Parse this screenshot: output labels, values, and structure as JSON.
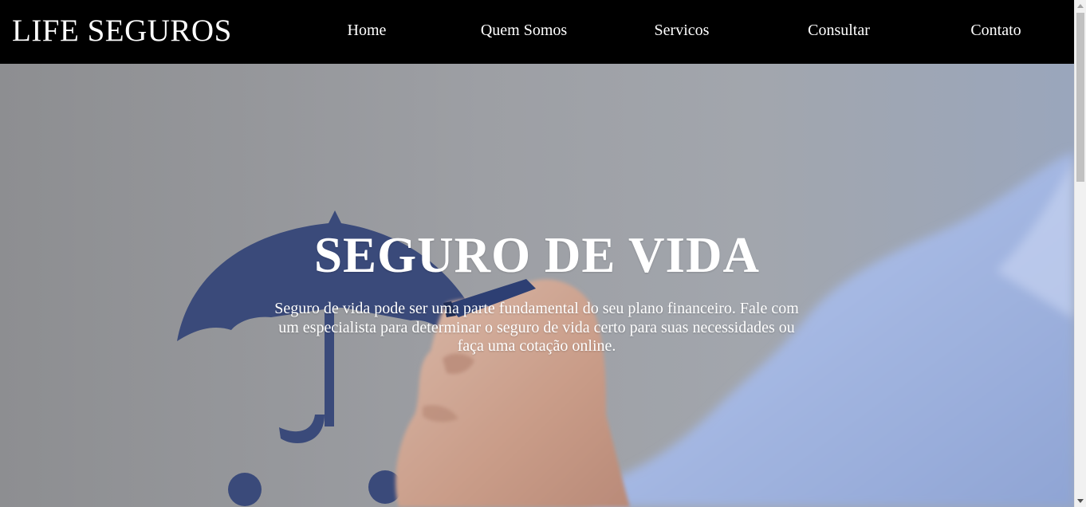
{
  "brand": "LIFE SEGUROS",
  "nav": {
    "items": [
      {
        "label": "Home"
      },
      {
        "label": "Quem Somos"
      },
      {
        "label": "Servicos"
      },
      {
        "label": "Consultar"
      },
      {
        "label": "Contato"
      }
    ]
  },
  "hero": {
    "title": "SEGURO DE VIDA",
    "text": "Seguro de vida pode ser uma parte fundamental do seu plano financeiro. Fale com um especialista para determinar o seguro de vida certo para suas necessidades ou faça uma cotação online."
  },
  "colors": {
    "navbar_bg": "#000000",
    "nav_text": "#ffffff",
    "umbrella": "#3a4a7a",
    "shirt": "#a9bce6"
  },
  "icons": {
    "umbrella": "umbrella-icon"
  }
}
